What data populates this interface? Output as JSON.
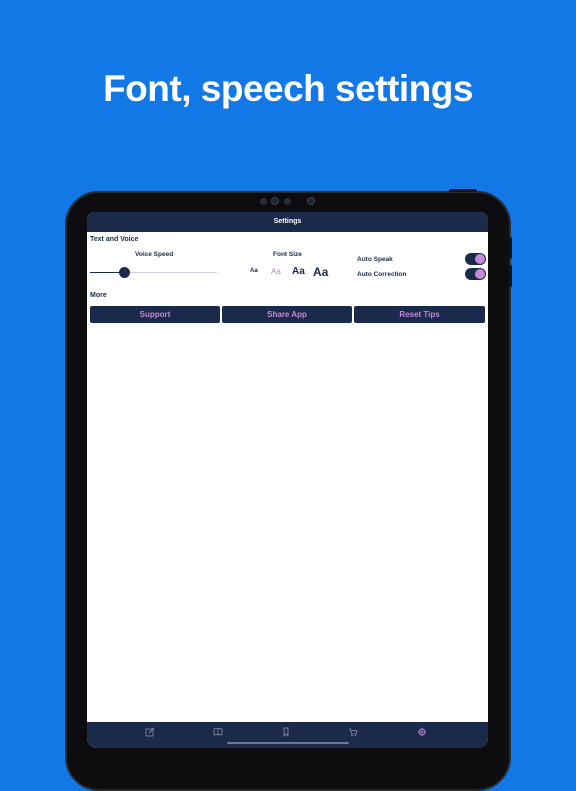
{
  "headline": "Font, speech settings",
  "navbar": {
    "title": "Settings"
  },
  "text_and_voice": {
    "section_title": "Text and Voice",
    "voice_speed": {
      "label": "Voice Speed",
      "value_fraction": 0.27
    },
    "font_size": {
      "label": "Font Size",
      "options": [
        "Aa",
        "Aa",
        "Aa",
        "Aa"
      ],
      "selected_index": 1
    },
    "auto_speak": {
      "label": "Auto Speak",
      "on": true
    },
    "auto_correction": {
      "label": "Auto Correction",
      "on": true
    }
  },
  "more": {
    "section_title": "More",
    "buttons": [
      "Support",
      "Share App",
      "Reset Tips"
    ]
  },
  "tabbar": {
    "tabs": [
      {
        "icon": "edit-icon"
      },
      {
        "icon": "book-icon"
      },
      {
        "icon": "bookmark-icon"
      },
      {
        "icon": "cart-icon"
      },
      {
        "icon": "settings-gear-icon",
        "active": true
      }
    ]
  },
  "colors": {
    "background": "#1178E6",
    "navy": "#1b2a4a",
    "accent_purple": "#c58ad9"
  }
}
